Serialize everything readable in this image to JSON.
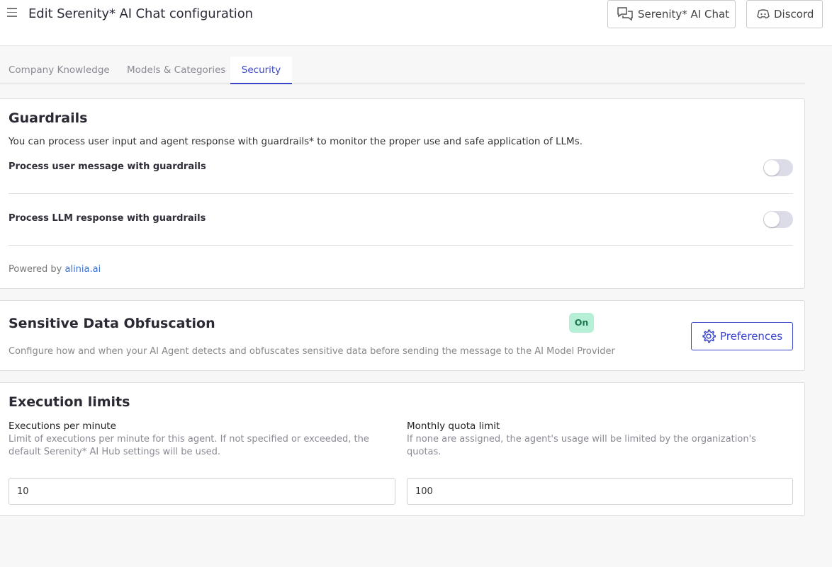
{
  "header": {
    "title": "Edit Serenity* AI Chat configuration",
    "chat_button_label": "Serenity* AI Chat",
    "discord_button_label": "Discord"
  },
  "tabs": [
    {
      "label": "Company Knowledge",
      "active": false
    },
    {
      "label": "Models & Categories",
      "active": false
    },
    {
      "label": "Security",
      "active": true
    }
  ],
  "guardrails": {
    "title": "Guardrails",
    "description": "You can process user input and agent response with guardrails* to monitor the proper use and safe application of LLMs.",
    "rows": [
      {
        "label": "Process user message with guardrails",
        "enabled": false
      },
      {
        "label": "Process LLM response with guardrails",
        "enabled": false
      }
    ],
    "powered_by_prefix": "Powered by ",
    "powered_by_link": "alinia.ai"
  },
  "obfuscation": {
    "title": "Sensitive Data Obfuscation",
    "status_badge": "On",
    "description": "Configure how and when your AI Agent detects and obfuscates sensitive data before sending the message to the AI Model Provider",
    "preferences_label": "Preferences"
  },
  "execution_limits": {
    "title": "Execution limits",
    "per_minute": {
      "label": "Executions per minute",
      "help": "Limit of executions per minute for this agent. If not specified or exceeded, the default Serenity* AI Hub settings will be used.",
      "value": "10"
    },
    "monthly_quota": {
      "label": "Monthly quota limit",
      "help": "If none are assigned, the agent's usage will be limited by the organization's quotas.",
      "value": "100"
    }
  },
  "colors": {
    "accent": "#3a45c9",
    "badge_bg": "#b5efd6",
    "badge_text": "#1d7a4f",
    "link": "#3a6fd6"
  }
}
